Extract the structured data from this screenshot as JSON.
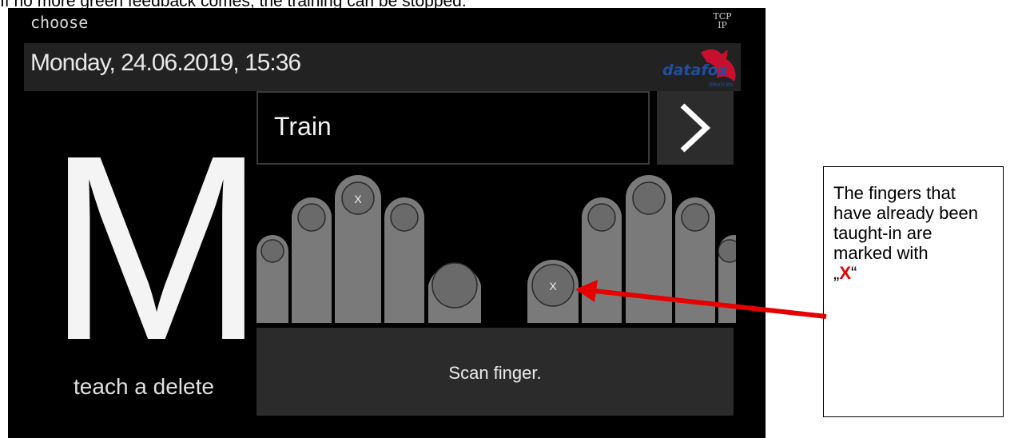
{
  "caption": "If no more green feedback comes, the training can be stopped.",
  "device": {
    "mode_label": "choose",
    "tcp_line1": "TCP",
    "tcp_line2": "IP",
    "datetime": "Monday, 24.06.2019, 15:36",
    "logo_text": "datafox",
    "logo_sub": "devices",
    "big_letter": "M",
    "mode_sub": "teach a delete",
    "train_label": "Train",
    "next_icon": "chevron-right-icon",
    "scan_text": "Scan finger.",
    "taught_mark": "X",
    "colors": {
      "background": "#000000",
      "panel": "#2b2b2b",
      "finger": "#7a7a7a",
      "logo_red": "#c8102e",
      "logo_blue": "#1f4fa0"
    }
  },
  "annotation": {
    "text": "The fingers that have already been taught-in are marked with",
    "quote_open": "„",
    "mark": "X",
    "quote_close": "“",
    "arrow_color": "#e60000"
  }
}
